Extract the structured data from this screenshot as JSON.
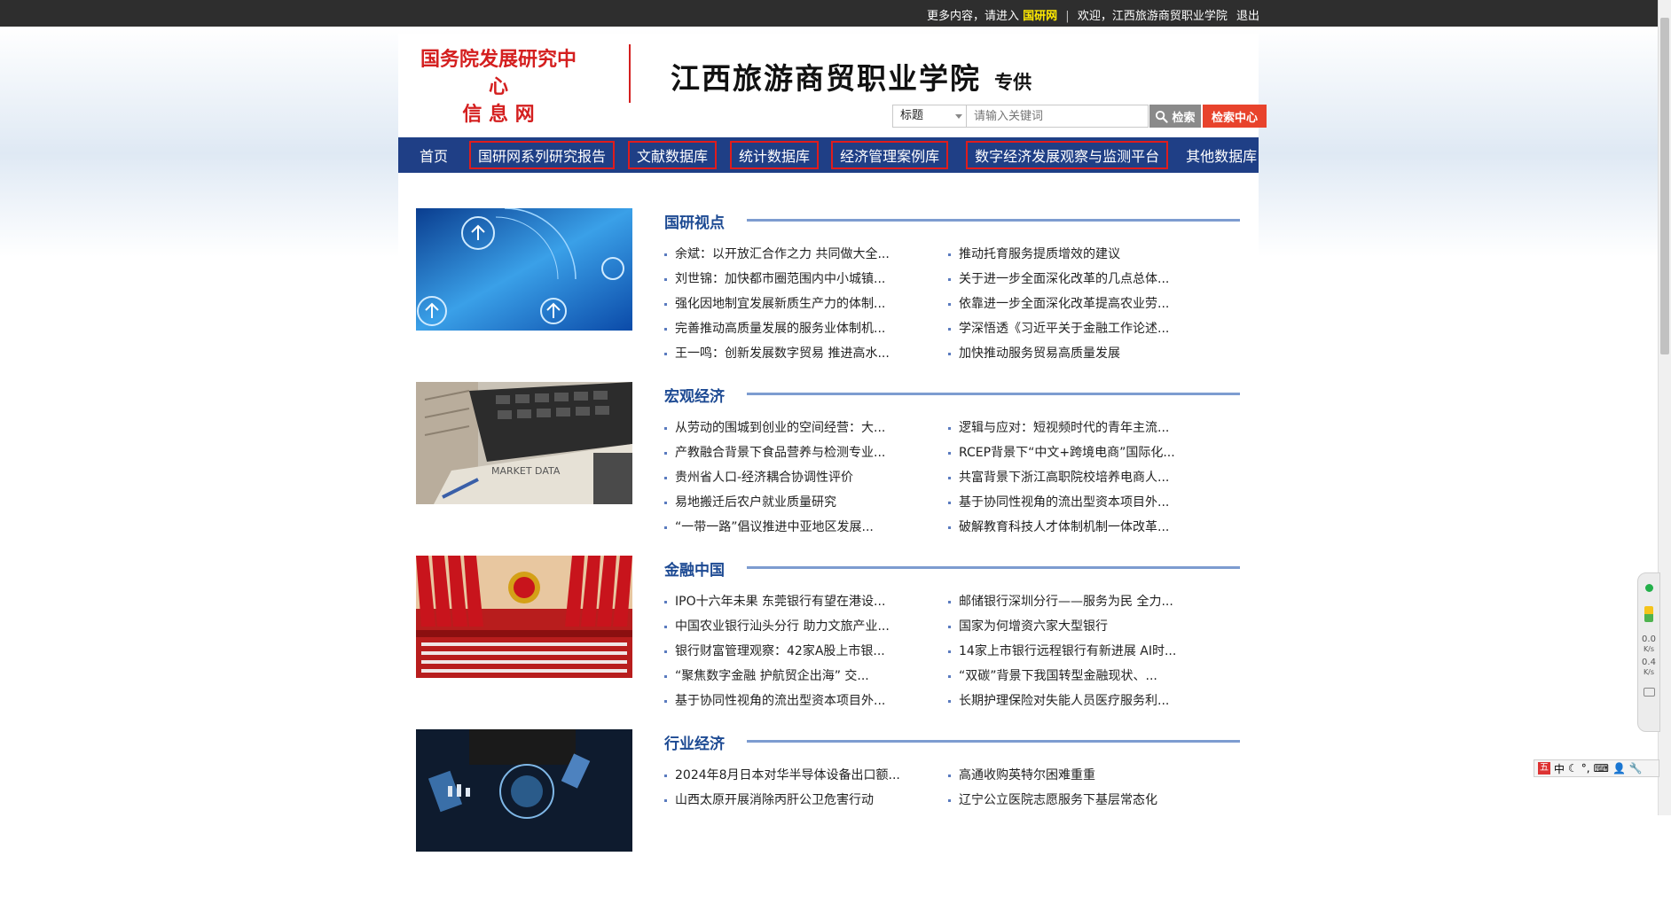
{
  "topbar": {
    "more_prefix": "更多内容，请进入",
    "brand": "国研网",
    "welcome": "欢迎，江西旅游商贸职业学院",
    "logout": "退出"
  },
  "header": {
    "logo_line1": "国务院发展研究中心",
    "logo_line2": "信 息 网",
    "school_name": "江西旅游商贸职业学院",
    "school_suffix": "专供"
  },
  "search": {
    "field_selected": "标题",
    "placeholder": "请输入关键词",
    "search_label": "检索",
    "center_label": "检索中心"
  },
  "nav": [
    {
      "label": "首页"
    },
    {
      "label": "国研网系列研究报告"
    },
    {
      "label": "文献数据库"
    },
    {
      "label": "统计数据库"
    },
    {
      "label": "经济管理案例库"
    },
    {
      "label": "数字经济发展观察与监测平台"
    },
    {
      "label": "其他数据库"
    }
  ],
  "sections": [
    {
      "title": "国研视点",
      "items": [
        "余斌：以开放汇合作之力 共同做大全...",
        "推动托育服务提质增效的建议",
        "刘世锦：加快都市圈范围内中小城镇...",
        "关于进一步全面深化改革的几点总体...",
        "强化因地制宜发展新质生产力的体制...",
        "依靠进一步全面深化改革提高农业劳...",
        "完善推动高质量发展的服务业体制机...",
        "学深悟透《习近平关于金融工作论述...",
        "王一鸣：创新发展数字贸易 推进高水...",
        "加快推动服务贸易高质量发展"
      ]
    },
    {
      "title": "宏观经济",
      "items": [
        "从劳动的围城到创业的空间经营：大...",
        "逻辑与应对：短视频时代的青年主流...",
        "产教融合背景下食品营养与检测专业...",
        "RCEP背景下“中文+跨境电商”国际化...",
        "贵州省人口-经济耦合协调性评价",
        "共富背景下浙江高职院校培养电商人...",
        "易地搬迁后农户就业质量研究",
        "基于协同性视角的流出型资本项目外...",
        "“一带一路”倡议推进中亚地区发展...",
        "破解教育科技人才体制机制一体改革..."
      ]
    },
    {
      "title": "金融中国",
      "items": [
        "IPO十六年未果 东莞银行有望在港设...",
        "邮储银行深圳分行——服务为民 全力...",
        "中国农业银行汕头分行 助力文旅产业...",
        "国家为何增资六家大型银行",
        "银行财富管理观察：42家A股上市银...",
        "14家上市银行远程银行有新进展 AI时...",
        "“聚焦数字金融 护航贸企出海” 交...",
        "“双碳”背景下我国转型金融现状、...",
        "基于协同性视角的流出型资本项目外...",
        "长期护理保险对失能人员医疗服务利..."
      ]
    },
    {
      "title": "行业经济",
      "items": [
        "2024年8月日本对华半导体设备出口额...",
        "高通收购英特尔困难重重",
        "山西太原开展消除丙肝公卫危害行动",
        "辽宁公立医院志愿服务下基层常态化"
      ]
    }
  ],
  "widget": {
    "rate_up": "0.0",
    "rate_down": "0.4",
    "rate_unit": "K/s"
  },
  "ime": {
    "logo": "五",
    "mode": "中"
  },
  "colors": {
    "nav_bg": "#1f3f86",
    "logo_red": "#d41f1f",
    "section_title": "#1d4a93",
    "search_center_btn": "#e8432c"
  }
}
